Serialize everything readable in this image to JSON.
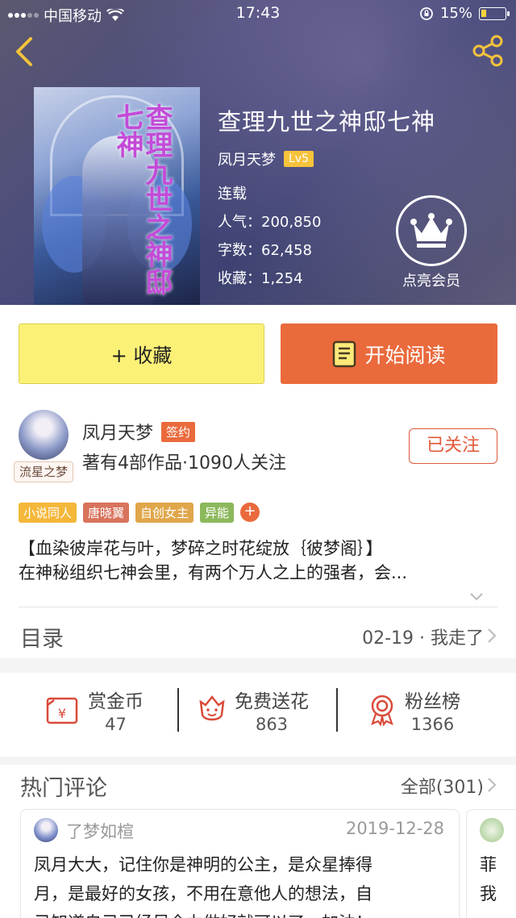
{
  "status": {
    "carrier": "中国移动",
    "time": "17:43",
    "battery": "15%"
  },
  "book": {
    "cover_title": "查理九世之神邸七神",
    "title": "查理九世之神邸七神",
    "author": "凤月天梦",
    "level": "Lv5",
    "state": "连载",
    "popularity": "人气：200,850",
    "words": "字数：62,458",
    "favorites": "收藏：1,254",
    "vip_label": "点亮会员"
  },
  "actions": {
    "favorite": "+ 收藏",
    "read": "开始阅读"
  },
  "author_card": {
    "avatar_tag": "流星之梦",
    "name": "凤月天梦",
    "signed": "签约",
    "stats": "著有4部作品·1090人关注",
    "follow_button": "已关注"
  },
  "tags": [
    {
      "label": "小说同人",
      "color": "#f4b73a"
    },
    {
      "label": "唐晓翼",
      "color": "#d9735c"
    },
    {
      "label": "自创女主",
      "color": "#e0a64a"
    },
    {
      "label": "异能",
      "color": "#8cb85c"
    },
    {
      "label": "+",
      "color": "#ea6a3c"
    }
  ],
  "description": [
    "【血染彼岸花与叶，梦碎之时花绽放｛彼梦阁｝】",
    "在神秘组织七神会里，有两个万人之上的强者，会..."
  ],
  "toc": {
    "label": "目录",
    "latest": "02-19 · 我走了"
  },
  "stats": [
    {
      "label": "赏金币",
      "value": "47"
    },
    {
      "label": "免费送花",
      "value": "863"
    },
    {
      "label": "粉丝榜",
      "value": "1366"
    }
  ],
  "comments": {
    "label": "热门评论",
    "all": "全部(301)",
    "items": [
      {
        "user": "了梦如楦",
        "date": "2019-12-28",
        "lines": [
          "凤月大大，记住你是神明的公主，是众星捧得",
          "月，是最好的女孩，不用在意他人的想法，自",
          "己知道自己已经尽全力做好就可以了，加油！"
        ]
      },
      {
        "lines": [
          "菲",
          "我"
        ]
      }
    ]
  }
}
